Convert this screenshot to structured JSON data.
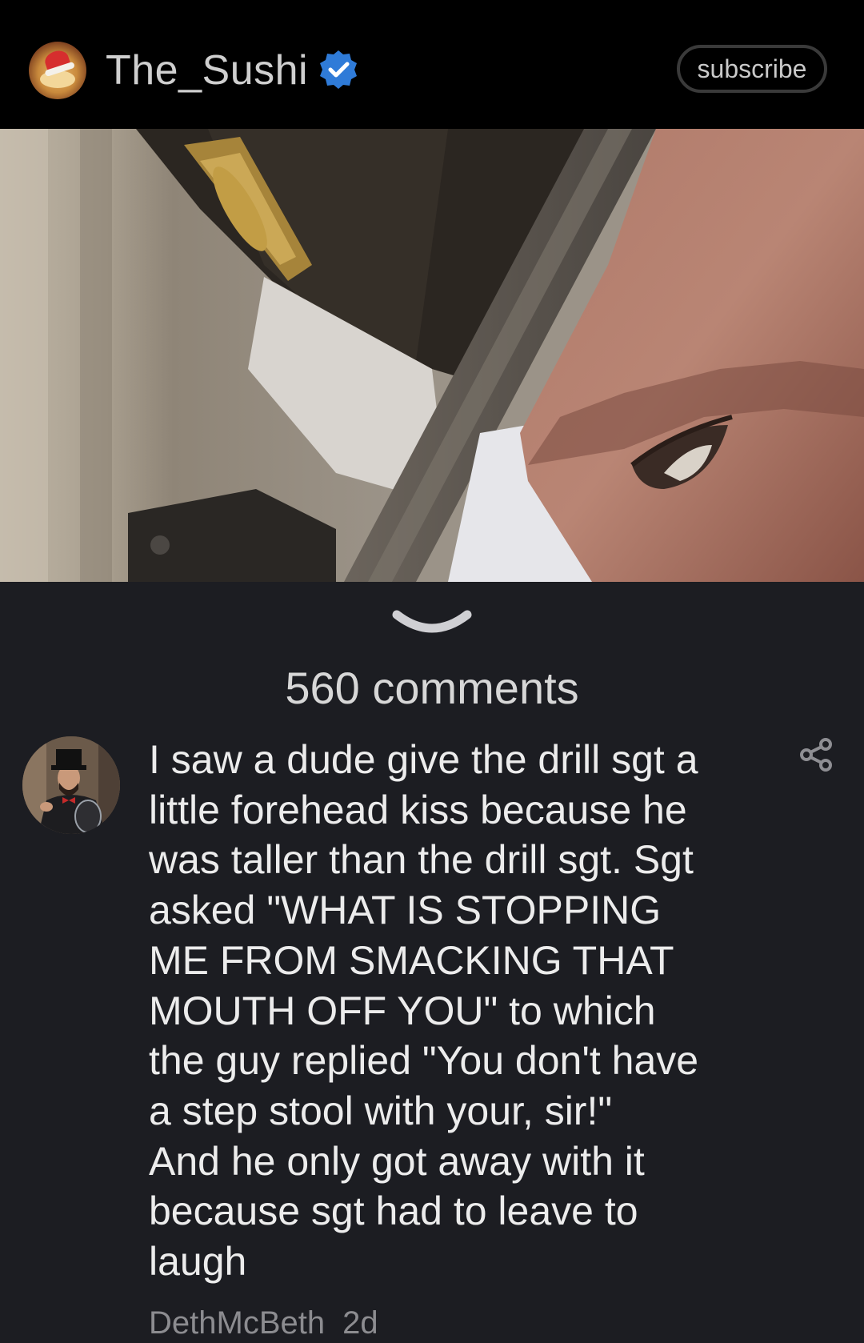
{
  "header": {
    "channel_name": "The_Sushi",
    "subscribe_label": "subscribe"
  },
  "comments": {
    "count_label": "560 comments",
    "items": [
      {
        "text": "I saw a dude give the drill sgt a\nlittle forehead kiss because he\nwas taller than the drill sgt. Sgt\nasked \"WHAT IS STOPPING\nME FROM SMACKING THAT\nMOUTH OFF YOU\" to which\nthe guy replied \"You don't have\na step stool with your, sir!\"\nAnd he only got away with it\nbecause sgt had to leave to\nlaugh",
        "author": "DethMcBeth",
        "time": "2d"
      }
    ]
  },
  "icons": {
    "verified": "verified-badge-icon",
    "share": "share-icon",
    "collapse": "chevron-down-icon"
  },
  "colors": {
    "header_bg": "#000000",
    "page_bg": "#1c1d22",
    "verified_blue": "#2f7bd8",
    "muted_text": "#8c8c90"
  }
}
